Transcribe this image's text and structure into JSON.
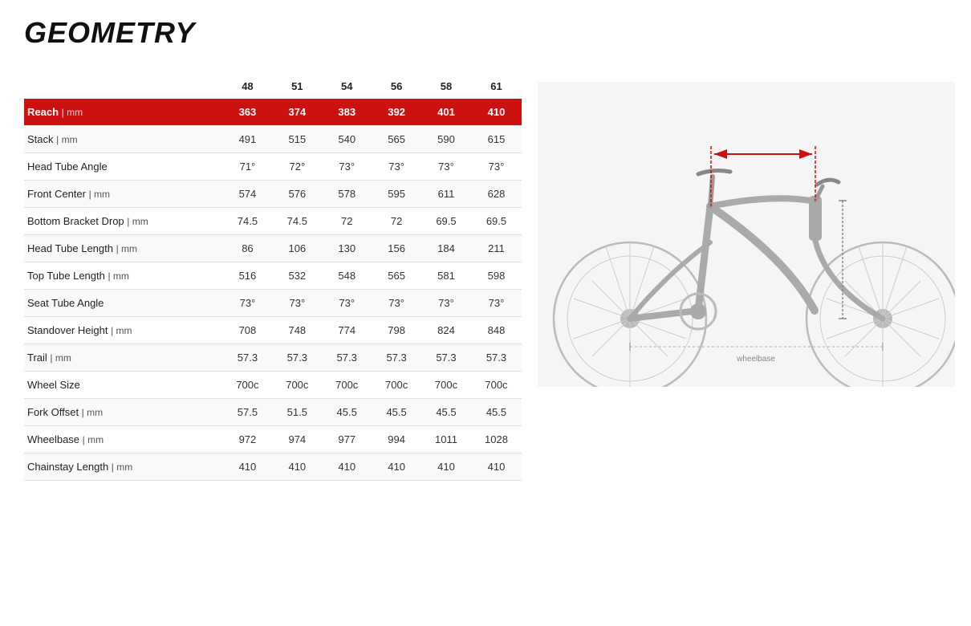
{
  "title": "GEOMETRY",
  "sizes": [
    "48",
    "51",
    "54",
    "56",
    "58",
    "61"
  ],
  "rows": [
    {
      "label": "Reach",
      "unit": "mm",
      "highlight": true,
      "values": [
        "363",
        "374",
        "383",
        "392",
        "401",
        "410"
      ]
    },
    {
      "label": "Stack",
      "unit": "mm",
      "highlight": false,
      "values": [
        "491",
        "515",
        "540",
        "565",
        "590",
        "615"
      ]
    },
    {
      "label": "Head Tube Angle",
      "unit": "",
      "highlight": false,
      "values": [
        "71°",
        "72°",
        "73°",
        "73°",
        "73°",
        "73°"
      ]
    },
    {
      "label": "Front Center",
      "unit": "mm",
      "highlight": false,
      "values": [
        "574",
        "576",
        "578",
        "595",
        "611",
        "628"
      ]
    },
    {
      "label": "Bottom Bracket Drop",
      "unit": "mm",
      "highlight": false,
      "values": [
        "74.5",
        "74.5",
        "72",
        "72",
        "69.5",
        "69.5"
      ]
    },
    {
      "label": "Head Tube Length",
      "unit": "mm",
      "highlight": false,
      "values": [
        "86",
        "106",
        "130",
        "156",
        "184",
        "211"
      ]
    },
    {
      "label": "Top Tube Length",
      "unit": "mm",
      "highlight": false,
      "values": [
        "516",
        "532",
        "548",
        "565",
        "581",
        "598"
      ]
    },
    {
      "label": "Seat Tube Angle",
      "unit": "",
      "highlight": false,
      "values": [
        "73°",
        "73°",
        "73°",
        "73°",
        "73°",
        "73°"
      ]
    },
    {
      "label": "Standover Height",
      "unit": "mm",
      "highlight": false,
      "values": [
        "708",
        "748",
        "774",
        "798",
        "824",
        "848"
      ]
    },
    {
      "label": "Trail",
      "unit": "mm",
      "highlight": false,
      "values": [
        "57.3",
        "57.3",
        "57.3",
        "57.3",
        "57.3",
        "57.3"
      ]
    },
    {
      "label": "Wheel Size",
      "unit": "",
      "highlight": false,
      "values": [
        "700c",
        "700c",
        "700c",
        "700c",
        "700c",
        "700c"
      ]
    },
    {
      "label": "Fork Offset",
      "unit": "mm",
      "highlight": false,
      "values": [
        "57.5",
        "51.5",
        "45.5",
        "45.5",
        "45.5",
        "45.5"
      ]
    },
    {
      "label": "Wheelbase",
      "unit": "mm",
      "highlight": false,
      "values": [
        "972",
        "974",
        "977",
        "994",
        "1011",
        "1028"
      ]
    },
    {
      "label": "Chainstay Length",
      "unit": "mm",
      "highlight": false,
      "values": [
        "410",
        "410",
        "410",
        "410",
        "410",
        "410"
      ]
    }
  ]
}
